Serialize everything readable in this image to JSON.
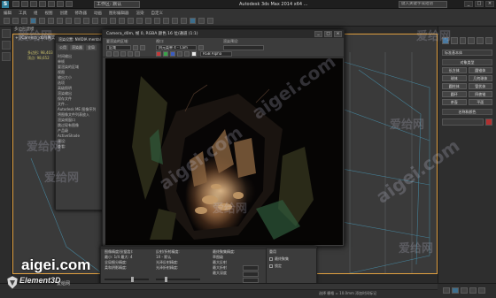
{
  "app": {
    "title": "Autodesk 3ds Max  2014 x64     ...",
    "workspace": "工作区: 默认",
    "search_placeholder": "键入关键字或短语"
  },
  "menubar": {
    "items": [
      "编辑",
      "工具",
      "组",
      "视图",
      "创建",
      "修改器",
      "动画",
      "图形编辑器",
      "渲染",
      "自定义"
    ]
  },
  "viewport": {
    "label": "+][Camera_d0][真实]",
    "stats": [
      "多边形: 98,403",
      "顶点: 98,652"
    ],
    "tab_label": "多边形建模"
  },
  "render_setup": {
    "title": "渲染设置: NVIDIA mental ray",
    "tabs": [
      "公用",
      "渲染器",
      "全局"
    ],
    "lines": [
      "时间输出",
      "单帧",
      "要渲染的区域",
      "视图",
      "输出大小",
      "选项",
      "高级照明",
      "渲染输出",
      "保存文件",
      "文件...",
      "Autodesk ME 图像序列",
      "将图像文件列表放入",
      "渲染帧窗口",
      "跳过现有图像",
      "产品级",
      "ActiveShade",
      "预设:",
      "查看:"
    ]
  },
  "frame_buffer": {
    "title": "Camera_d0m, 帧 0, RGBA 颜色 16 位/通道 (1:1)",
    "area_label": "要渲染的区域:",
    "area_value": "区域",
    "viewport_label": "视口:",
    "viewport_value": "四元菜单 4 - Cam",
    "preset_label": "渲染预设:",
    "channel_value": "RGB Alpha",
    "min_label": "_",
    "max_label": "□",
    "close_label": "×"
  },
  "rvp_panel": {
    "col1": [
      "图像精度(抗锯齿):",
      "最小: 1/4  最大: 4",
      "全局细分精度:",
      "柔和阴影精度:"
    ],
    "col2": [
      "反射/折射精度:",
      "1X - 默认",
      "光泽反射精度:",
      "光泽折射精度:"
    ],
    "col3": [
      "最终聚集精度:",
      "草图级",
      "最大反射",
      "最大折射",
      "最大深度"
    ],
    "col4": [
      "重用",
      "最终聚集",
      "锁定"
    ]
  },
  "command_panel": {
    "dropdown": "标准基本体",
    "rollout1": "对象类型",
    "buttons": [
      "长方体",
      "圆锥体",
      "球体",
      "几何球体",
      "圆柱体",
      "管状体",
      "圆环",
      "四棱锥",
      "茶壶",
      "平面"
    ],
    "rollout2": "名称和颜色",
    "color": "#b03030"
  },
  "status": {
    "text": "选择  栅格 = 10.0mm  添加时间标记"
  },
  "watermarks": {
    "site": "aigei.com",
    "cn": "爱给网",
    "brand_main": "aigei.com",
    "brand_sub": "Element3D",
    "brand_cn": "爱给网"
  },
  "colors": {
    "accent": "#3d6f8e",
    "viewport_border": "#e0a040",
    "cave_light": "#c8a070"
  }
}
